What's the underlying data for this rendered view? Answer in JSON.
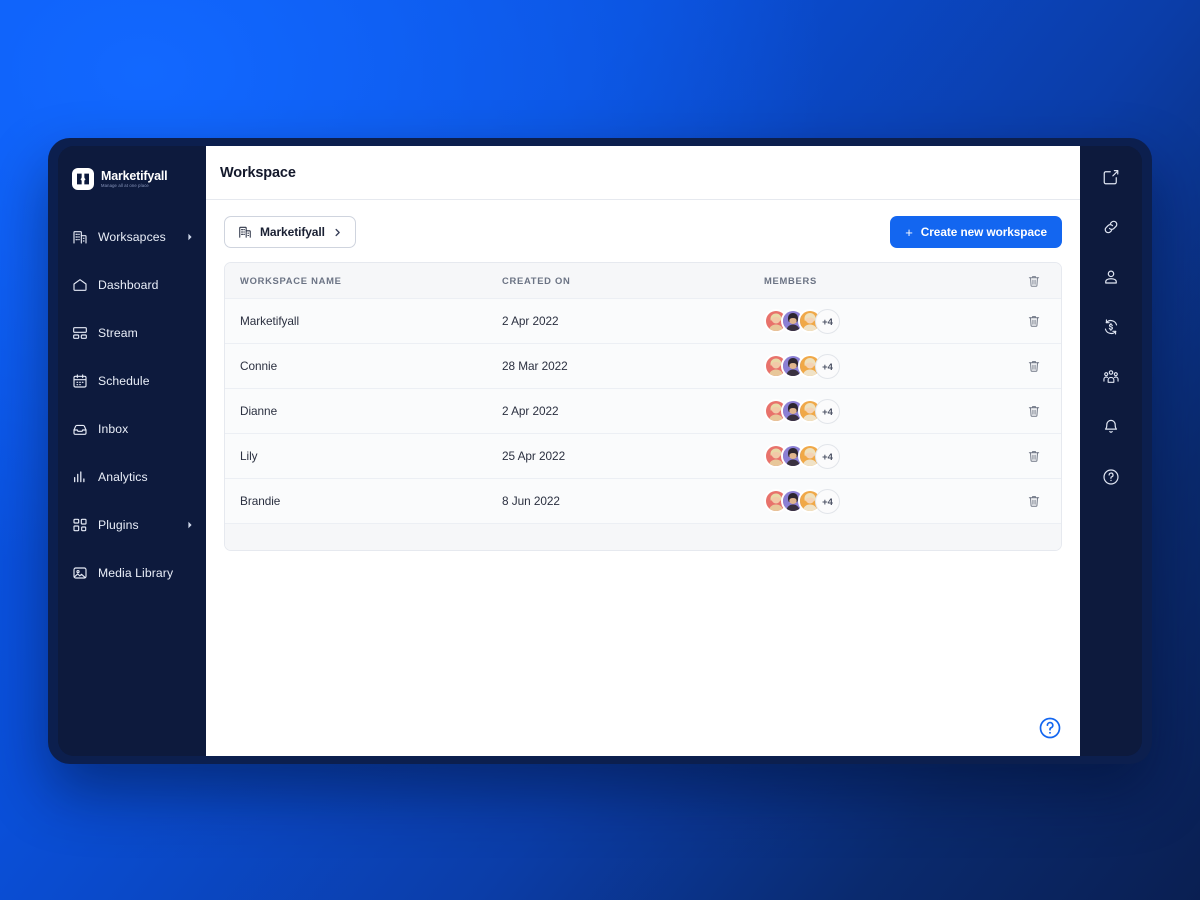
{
  "brand": {
    "name": "Marketifyall",
    "tagline": "Manage all at one place",
    "logo_icon": "marketifyall-logo-icon"
  },
  "sidebar": {
    "items": [
      {
        "label": "Worksapces",
        "icon": "building-icon",
        "has_caret": true
      },
      {
        "label": "Dashboard",
        "icon": "home-icon",
        "has_caret": false
      },
      {
        "label": "Stream",
        "icon": "stream-icon",
        "has_caret": false
      },
      {
        "label": "Schedule",
        "icon": "calendar-icon",
        "has_caret": false
      },
      {
        "label": "Inbox",
        "icon": "inbox-icon",
        "has_caret": false
      },
      {
        "label": "Analytics",
        "icon": "bar-chart-icon",
        "has_caret": false
      },
      {
        "label": "Plugins",
        "icon": "grid-blocks-icon",
        "has_caret": true
      },
      {
        "label": "Media Library",
        "icon": "image-icon",
        "has_caret": false
      }
    ]
  },
  "header": {
    "title": "Workspace"
  },
  "toolbar": {
    "workspace_chip": {
      "label": "Marketifyall",
      "icon": "building-icon",
      "chevron": "chevron-right-icon"
    },
    "create_button": {
      "label": "Create new workspace",
      "plus": "+"
    }
  },
  "table": {
    "columns": [
      "WORKSPACE NAME",
      "CREATED ON",
      "MEMBERS"
    ],
    "header_action_icon": "trash-icon",
    "rows": [
      {
        "name": "Marketifyall",
        "created_on": "2 Apr 2022",
        "members_extra": "+4",
        "action_icon": "trash-icon"
      },
      {
        "name": "Connie",
        "created_on": "28 Mar 2022",
        "members_extra": "+4",
        "action_icon": "trash-icon"
      },
      {
        "name": "Dianne",
        "created_on": "2 Apr 2022",
        "members_extra": "+4",
        "action_icon": "trash-icon"
      },
      {
        "name": "Lily",
        "created_on": "25 Apr 2022",
        "members_extra": "+4",
        "action_icon": "trash-icon"
      },
      {
        "name": "Brandie",
        "created_on": "8 Jun 2022",
        "members_extra": "+4",
        "action_icon": "trash-icon"
      }
    ],
    "avatar_colors": [
      "#e8726b",
      "#8b7fd4",
      "#f0a847"
    ]
  },
  "help_fab": {
    "icon": "help-circle-icon"
  },
  "right_rail": {
    "items": [
      {
        "icon": "compose-icon"
      },
      {
        "icon": "link-icon"
      },
      {
        "icon": "user-icon"
      },
      {
        "icon": "dollar-refresh-icon"
      },
      {
        "icon": "people-group-icon"
      },
      {
        "icon": "bell-icon"
      },
      {
        "icon": "help-circle-icon"
      }
    ]
  },
  "colors": {
    "accent": "#1366f0",
    "sidebar_bg": "#0d1a3d",
    "page_bg_start": "#0a57ef",
    "page_bg_end": "#0a1f52"
  }
}
